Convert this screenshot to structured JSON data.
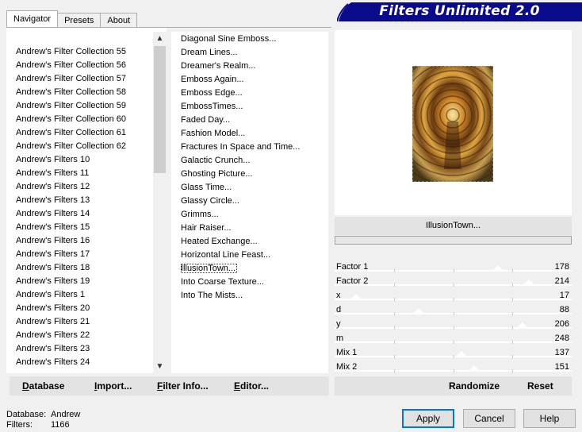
{
  "tabs": [
    "Navigator",
    "Presets",
    "About"
  ],
  "banner_title": "Filters Unlimited 2.0",
  "left_list": [
    "Andrew's Filter Collection 55",
    "Andrew's Filter Collection 56",
    "Andrew's Filter Collection 57",
    "Andrew's Filter Collection 58",
    "Andrew's Filter Collection 59",
    "Andrew's Filter Collection 60",
    "Andrew's Filter Collection 61",
    "Andrew's Filter Collection 62",
    "Andrew's Filters 10",
    "Andrew's Filters 11",
    "Andrew's Filters 12",
    "Andrew's Filters 13",
    "Andrew's Filters 14",
    "Andrew's Filters 15",
    "Andrew's Filters 16",
    "Andrew's Filters 17",
    "Andrew's Filters 18",
    "Andrew's Filters 19",
    "Andrew's Filters 1",
    "Andrew's Filters 20",
    "Andrew's Filters 21",
    "Andrew's Filters 22",
    "Andrew's Filters 23",
    "Andrew's Filters 24"
  ],
  "filter_list": [
    "Diagonal Sine Emboss...",
    "Dream Lines...",
    "Dreamer's Realm...",
    "Emboss Again...",
    "Emboss Edge...",
    "EmbossTimes...",
    "Faded Day...",
    "Fashion Model...",
    "Fractures In Space and Time...",
    "Galactic Crunch...",
    "Ghosting Picture...",
    "Glass Time...",
    "Glassy Circle...",
    "Grimms...",
    "Hair Raiser...",
    "Heated Exchange...",
    "Horizontal Line Feast...",
    "IllusionTown...",
    "Into Coarse Texture...",
    "Into The Mists..."
  ],
  "selected_filter": "IllusionTown...",
  "params": [
    {
      "name": "Factor 1",
      "value": 178
    },
    {
      "name": "Factor 2",
      "value": 214
    },
    {
      "name": "x",
      "value": 17
    },
    {
      "name": "d",
      "value": 88
    },
    {
      "name": "y",
      "value": 206
    },
    {
      "name": "m",
      "value": 248
    },
    {
      "name": "Mix 1",
      "value": 137
    },
    {
      "name": "Mix 2",
      "value": 151
    }
  ],
  "bottom_left_buttons": {
    "database": {
      "u": "D",
      "rest": "atabase"
    },
    "import": {
      "u": "I",
      "rest": "mport..."
    },
    "filter_info": {
      "u": "F",
      "rest": "ilter Info..."
    },
    "editor": {
      "u": "E",
      "rest": "ditor..."
    }
  },
  "randomize_label": "Randomize",
  "reset_label": "Reset",
  "status": {
    "database_label": "Database:",
    "database_value": "Andrew",
    "filters_label": "Filters:",
    "filters_value": "1166"
  },
  "buttons": {
    "apply": "Apply",
    "cancel": "Cancel",
    "help": "Help"
  },
  "colors": {
    "banner": "#0a0a8c",
    "accent": "#0078d7"
  }
}
